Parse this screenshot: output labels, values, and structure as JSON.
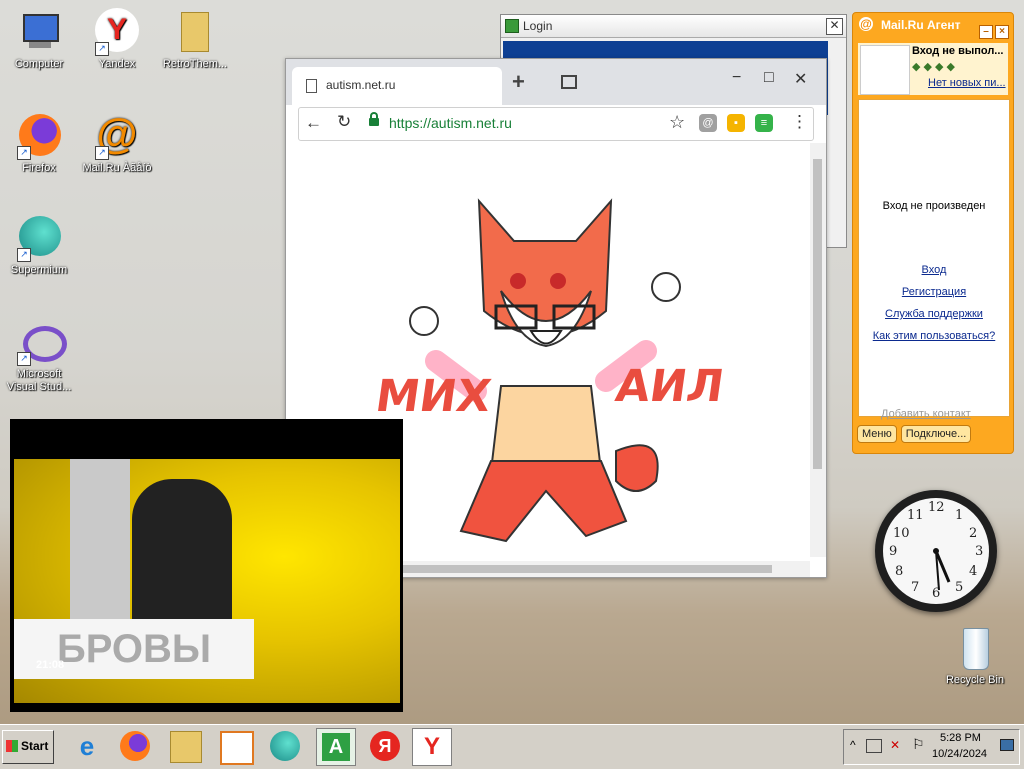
{
  "desktop_icons": [
    {
      "label": "Computer"
    },
    {
      "label": "Yandex"
    },
    {
      "label": "RetroThem..."
    },
    {
      "label": "Firefox"
    },
    {
      "label": "Mail.Ru Àãåíò"
    },
    {
      "label": "Supermium"
    },
    {
      "label": "Microsoft Visual Stud..."
    },
    {
      "label": "Recycle Bin"
    }
  ],
  "login_window": {
    "title": "Login",
    "close": "✕"
  },
  "browser": {
    "tab_title": "autism.net.ru",
    "new_tab": "+",
    "url": "https://autism.net.ru",
    "minimize": "−",
    "maximize": "□",
    "close": "✕",
    "back": "←",
    "reload": "↻",
    "star": "☆",
    "menu": "⋮",
    "sticker_text_left": "МИХ",
    "sticker_text_right": "АИЛ"
  },
  "mail_agent": {
    "title": "Mail.Ru Агент",
    "status": "Вход не выпол...",
    "no_new_mail": "Нет новых пи...",
    "not_logged_in": "Вход не произведен",
    "links": [
      "Вход",
      "Регистрация",
      "Служба поддержки",
      "Как этим пользоваться?"
    ],
    "add_contact": "Добавить контакт",
    "menu_button": "Меню",
    "connect_button": "Подключе..."
  },
  "clock": {
    "numbers": [
      "12",
      "1",
      "2",
      "3",
      "4",
      "5",
      "6",
      "7",
      "8",
      "9",
      "10",
      "11"
    ]
  },
  "video": {
    "time_overlay": "21:08",
    "caption": "БРОВЫ"
  },
  "taskbar": {
    "start_label": "Start",
    "time": "5:28 PM",
    "date": "10/24/2024"
  },
  "colors": {
    "agent_orange": "#fda820",
    "url_green": "#188038",
    "sticker_red": "#e94d3f",
    "video_yellow": "#ffe600"
  }
}
